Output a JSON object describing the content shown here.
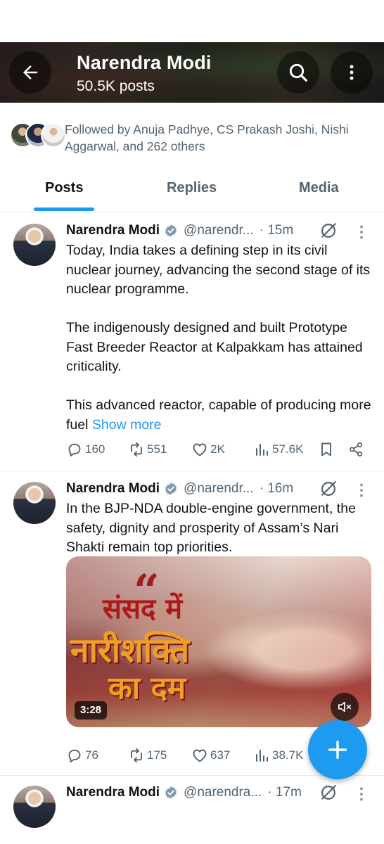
{
  "header": {
    "title": "Narendra Modi",
    "subtitle": "50.5K posts",
    "back_icon": "arrow-left-icon",
    "search_icon": "search-icon",
    "more_icon": "more-vertical-icon"
  },
  "followed_by": {
    "text": "Followed by Anuja Padhye, CS Prakash Joshi, Nishi Aggarwal, and 262 others"
  },
  "tabs": [
    {
      "label": "Posts",
      "selected": true
    },
    {
      "label": "Replies",
      "selected": false
    },
    {
      "label": "Media",
      "selected": false
    }
  ],
  "posts": [
    {
      "author": "Narendra Modi",
      "handle": "@narendr...",
      "time": "· 15m",
      "paragraphs": [
        "Today, India takes a defining step in its civil nuclear journey, advancing the second stage of its nuclear programme.",
        "The indigenously designed and built Prototype Fast Breeder Reactor at Kalpakkam has attained criticality.",
        "This advanced reactor, capable of producing more fuel"
      ],
      "show_more": "Show more",
      "replies": "160",
      "reposts": "551",
      "likes": "2K",
      "views": "57.6K"
    },
    {
      "author": "Narendra Modi",
      "handle": "@narendr...",
      "time": "· 16m",
      "paragraphs": [
        "In the BJP-NDA double-engine government, the safety, dignity and prosperity of Assam’s Nari Shakti remain top priorities."
      ],
      "media": {
        "quote_mark": "“",
        "line1": "संसद में",
        "line2": "नारीशक्ति",
        "line3": "का दम",
        "duration": "3:28"
      },
      "replies": "76",
      "reposts": "175",
      "likes": "637",
      "views": "38.7K"
    },
    {
      "author": "Narendra Modi",
      "handle": "@narendra...",
      "time": "· 17m"
    }
  ],
  "colors": {
    "accent": "#1d9bf0",
    "text_primary": "#0f1419",
    "text_secondary": "#536471"
  }
}
